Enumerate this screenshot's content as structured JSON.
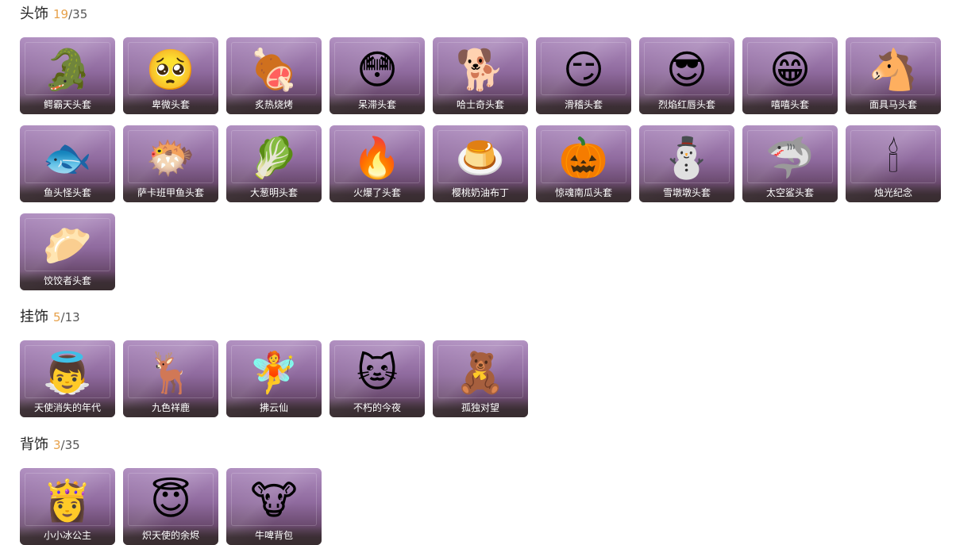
{
  "sections": [
    {
      "title": "头饰",
      "owned": "19",
      "separator": "/",
      "total": "35",
      "items": [
        {
          "label": "鳄霸天头套",
          "icon": "crocodile-head-icon",
          "glyph": "🐊"
        },
        {
          "label": "卑微头套",
          "icon": "humble-face-icon",
          "glyph": "🥺"
        },
        {
          "label": "炙热烧烤",
          "icon": "grilled-meat-icon",
          "glyph": "🍖"
        },
        {
          "label": "呆滞头套",
          "icon": "dazed-face-icon",
          "glyph": "😳"
        },
        {
          "label": "哈士奇头套",
          "icon": "husky-head-icon",
          "glyph": "🐕"
        },
        {
          "label": "滑稽头套",
          "icon": "funny-face-icon",
          "glyph": "😏"
        },
        {
          "label": "烈焰红唇头套",
          "icon": "pikachu-sunglasses-icon",
          "glyph": "😎"
        },
        {
          "label": "嘻嘻头套",
          "icon": "grin-face-icon",
          "glyph": "😁"
        },
        {
          "label": "面具马头套",
          "icon": "horse-mask-icon",
          "glyph": "🐴"
        },
        {
          "label": "鱼头怪头套",
          "icon": "fish-head-icon",
          "glyph": "🐟"
        },
        {
          "label": "萨卡班甲鱼头套",
          "icon": "sacabambaspis-icon",
          "glyph": "🐡"
        },
        {
          "label": "大葱明头套",
          "icon": "green-onion-icon",
          "glyph": "🥬"
        },
        {
          "label": "火爆了头套",
          "icon": "fire-head-icon",
          "glyph": "🔥"
        },
        {
          "label": "樱桃奶油布丁",
          "icon": "pudding-icon",
          "glyph": "🍮"
        },
        {
          "label": "惊魂南瓜头套",
          "icon": "pumpkin-head-icon",
          "glyph": "🎃"
        },
        {
          "label": "雪墩墩头套",
          "icon": "snowman-head-icon",
          "glyph": "⛄"
        },
        {
          "label": "太空鲨头套",
          "icon": "space-shark-icon",
          "glyph": "🦈"
        },
        {
          "label": "烛光纪念",
          "icon": "candle-icon",
          "glyph": "🕯"
        },
        {
          "label": "饺饺者头套",
          "icon": "dumpling-head-icon",
          "glyph": "🥟"
        }
      ]
    },
    {
      "title": "挂饰",
      "owned": "5",
      "separator": "/",
      "total": "13",
      "items": [
        {
          "label": "天使消失的年代",
          "icon": "angel-doll-icon",
          "glyph": "👼"
        },
        {
          "label": "九色祥鹿",
          "icon": "deer-charm-icon",
          "glyph": "🦌"
        },
        {
          "label": "拂云仙",
          "icon": "cloud-fairy-icon",
          "glyph": "🧚"
        },
        {
          "label": "不朽的今夜",
          "icon": "pink-cat-icon",
          "glyph": "🐱"
        },
        {
          "label": "孤独对望",
          "icon": "lonely-gaze-icon",
          "glyph": "🧸"
        }
      ]
    },
    {
      "title": "背饰",
      "owned": "3",
      "separator": "/",
      "total": "35",
      "items": [
        {
          "label": "小小冰公主",
          "icon": "ice-princess-icon",
          "glyph": "👸"
        },
        {
          "label": "炽天使的余烬",
          "icon": "seraph-doll-icon",
          "glyph": "😇"
        },
        {
          "label": "牛啤背包",
          "icon": "cow-backpack-icon",
          "glyph": "🐮"
        }
      ]
    }
  ],
  "colors": {
    "owned_count": "#e7a14a",
    "card_top": "#b08fc0",
    "card_bottom": "#4a3a40",
    "label_text": "#ffffff"
  }
}
